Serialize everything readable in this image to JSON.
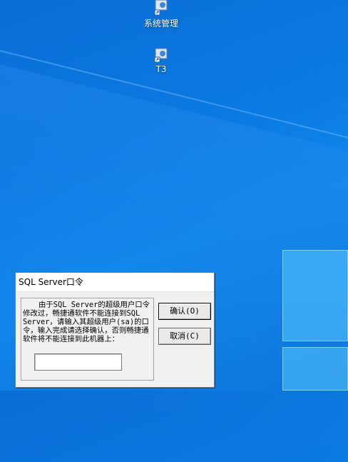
{
  "desktop": {
    "icons": [
      {
        "label": "系统管理",
        "icon": "app-shortcut-icon"
      },
      {
        "label": "T3",
        "icon": "app-shortcut-icon"
      }
    ]
  },
  "dialog": {
    "title": "SQL Server口令",
    "message": "由于SQL Server的超级用户口令修改过，畅捷通软件不能连接到SQL Server，请输入其超级用户(sa)的口令，输入完成请选择确认，否则畅捷通软件将不能连接到此机器上：",
    "password_value": "",
    "ok_label": "确认(O)",
    "cancel_label": "取消(C)"
  }
}
